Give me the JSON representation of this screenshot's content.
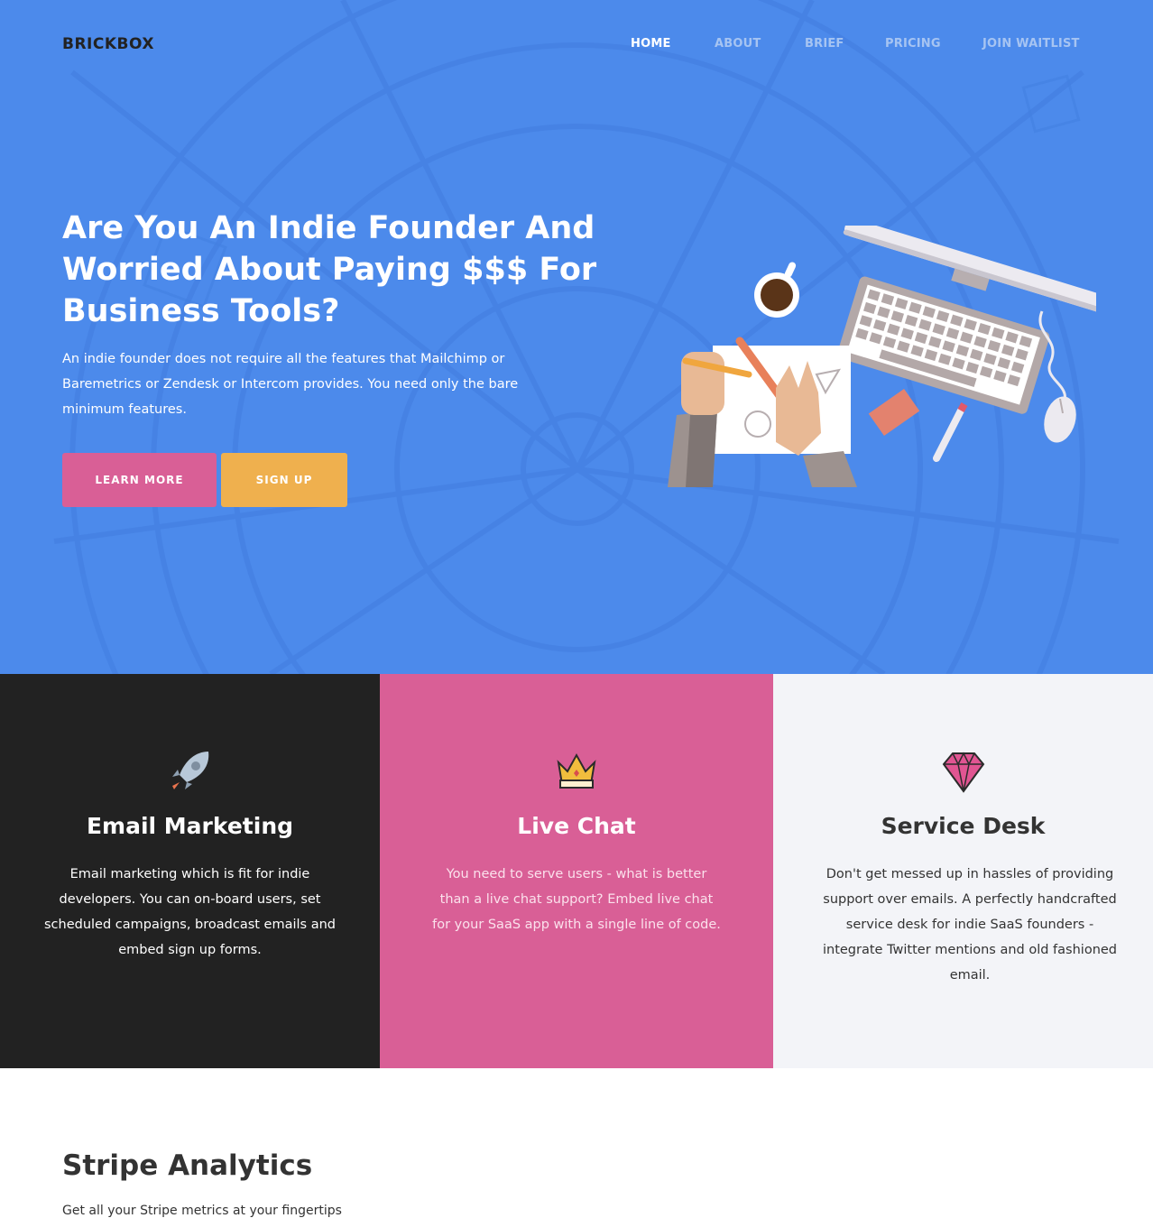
{
  "brand": {
    "logo": "BRICKBOX"
  },
  "nav": {
    "items": [
      {
        "label": "HOME",
        "active": true
      },
      {
        "label": "ABOUT",
        "active": false
      },
      {
        "label": "BRIEF",
        "active": false
      },
      {
        "label": "PRICING",
        "active": false
      },
      {
        "label": "JOIN WAITLIST",
        "active": false
      }
    ]
  },
  "hero": {
    "title": "Are You An Indie Founder And Worried About Paying $$$ For Business Tools?",
    "subtitle": "An indie founder does not require all the features that Mailchimp or Baremetrics or Zendesk or Intercom provides. You need only the bare minimum features.",
    "learn_more_label": "LEARN MORE",
    "sign_up_label": "SIGN UP",
    "illustration": "desk-workspace-illustration"
  },
  "features": [
    {
      "icon": "rocket-icon",
      "title": "Email Marketing",
      "text": "Email marketing which is fit for indie developers. You can on-board users, set scheduled campaigns, broadcast emails and embed sign up forms."
    },
    {
      "icon": "crown-icon",
      "title": "Live Chat",
      "text": "You need to serve users - what is better than a live chat support? Embed live chat for your SaaS app with a single line of code."
    },
    {
      "icon": "diamond-icon",
      "title": "Service Desk",
      "text": "Don't get messed up in hassles of providing support over emails. A perfectly handcrafted service desk for indie SaaS founders - integrate Twitter mentions and old fashioned email."
    }
  ],
  "stripe_section": {
    "title": "Stripe Analytics",
    "subtitle": "Get all your Stripe metrics at your fingertips"
  },
  "colors": {
    "hero_bg": "#4c8aeb",
    "accent_pink": "#d95f96",
    "accent_orange": "#efb04e",
    "dark": "#222222",
    "light": "#f3f4f8"
  }
}
